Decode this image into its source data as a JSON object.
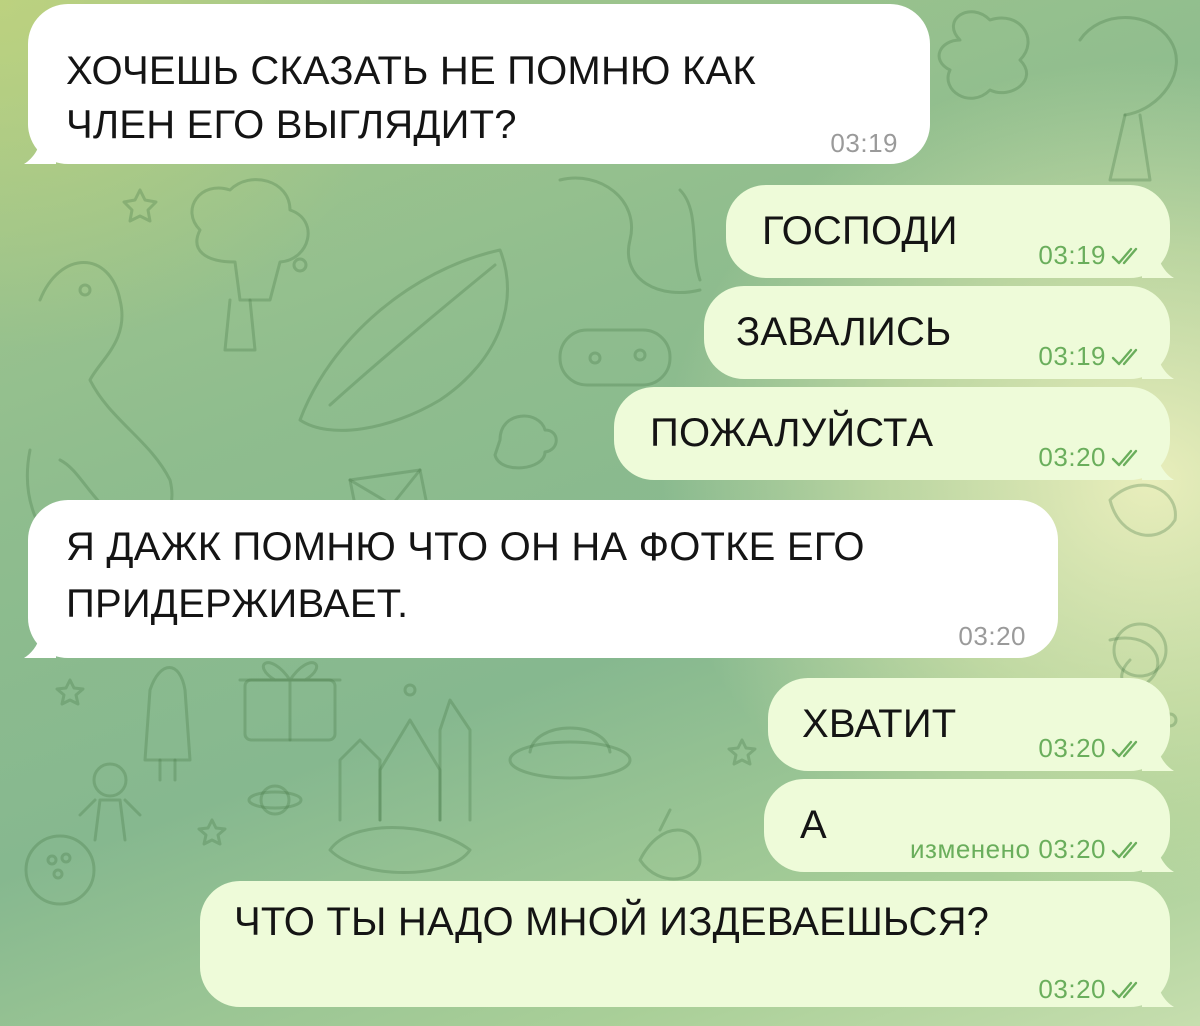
{
  "colors": {
    "incoming_bubble": "#ffffff",
    "outgoing_bubble": "#eefbd9",
    "outgoing_meta": "#6aae5c",
    "incoming_meta": "#9a9a9a",
    "wallpaper": "#8fbd8e"
  },
  "messages": [
    {
      "direction": "in",
      "lines": [
        "ХОЧЕШЬ СКАЗАТЬ НЕ ПОМНЮ КАК",
        "ЧЛЕН ЕГО ВЫГЛЯДИТ?"
      ],
      "time": "03:19"
    },
    {
      "direction": "out",
      "lines": [
        "ГОСПОДИ"
      ],
      "time": "03:19",
      "status_icon": "double-check-icon"
    },
    {
      "direction": "out",
      "lines": [
        "ЗАВАЛИСЬ"
      ],
      "time": "03:19",
      "status_icon": "double-check-icon"
    },
    {
      "direction": "out",
      "lines": [
        "ПОЖАЛУЙСТА"
      ],
      "time": "03:20",
      "status_icon": "double-check-icon"
    },
    {
      "direction": "in",
      "lines": [
        "Я ДАЖК ПОМНЮ ЧТО ОН НА ФОТКЕ ЕГО",
        "ПРИДЕРЖИВАЕТ."
      ],
      "time": "03:20"
    },
    {
      "direction": "out",
      "lines": [
        "ХВАТИТ"
      ],
      "time": "03:20",
      "status_icon": "double-check-icon"
    },
    {
      "direction": "out",
      "lines": [
        "А"
      ],
      "edited_label": "изменено",
      "time": "03:20",
      "status_icon": "double-check-icon"
    },
    {
      "direction": "out",
      "lines": [
        "ЧТО ТЫ НАДО МНОЙ ИЗДЕВАЕШЬСЯ?"
      ],
      "time": "03:20",
      "status_icon": "double-check-icon"
    }
  ]
}
